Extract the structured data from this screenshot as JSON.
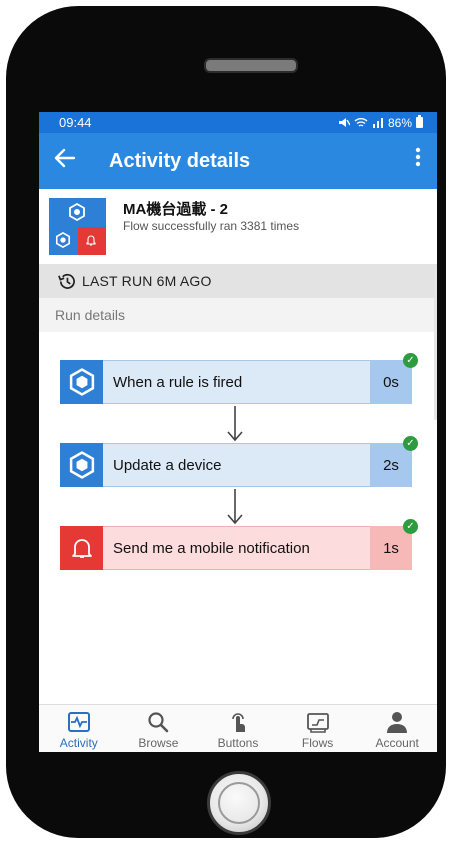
{
  "status_bar": {
    "time": "09:44",
    "battery": "86%"
  },
  "app_bar": {
    "title": "Activity details"
  },
  "flow": {
    "name": "MA機台過載 - 2",
    "summary": "Flow successfully ran 3381 times"
  },
  "last_run": {
    "label": "LAST RUN 6M AGO"
  },
  "run_details": {
    "label": "Run details"
  },
  "steps": [
    {
      "label": "When a rule is fired",
      "duration": "0s",
      "status": "succeeded",
      "icon": "iot-hexagon-icon"
    },
    {
      "label": "Update a device",
      "duration": "2s",
      "status": "succeeded",
      "icon": "iot-hexagon-icon"
    },
    {
      "label": "Send me a mobile notification",
      "duration": "1s",
      "status": "succeeded",
      "icon": "bell-icon"
    }
  ],
  "bottom_nav": [
    {
      "label": "Activity",
      "icon": "activity-icon",
      "active": true
    },
    {
      "label": "Browse",
      "icon": "search-icon",
      "active": false
    },
    {
      "label": "Buttons",
      "icon": "tap-hand-icon",
      "active": false
    },
    {
      "label": "Flows",
      "icon": "flows-icon",
      "active": false
    },
    {
      "label": "Account",
      "icon": "person-icon",
      "active": false
    }
  ],
  "colors": {
    "status_bar": "#1a73d9",
    "app_bar": "#2b88e0",
    "step_blue": "#2e7fd6",
    "step_red": "#e53935",
    "success": "#2e9b3f"
  }
}
